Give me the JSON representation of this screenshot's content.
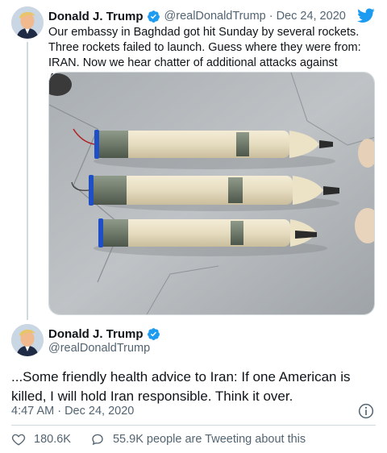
{
  "parent_tweet": {
    "author_name": "Donald J. Trump",
    "handle": "@realDonaldTrump",
    "separator": "·",
    "date": "Dec 24, 2020",
    "text": "Our embassy in Baghdad got hit Sunday by several rockets. Three rockets failed to launch. Guess where they were from: IRAN. Now we hear chatter of additional attacks against Americans in Iraq...",
    "media_icon": "photo-of-three-rockets",
    "brand_icon": "twitter-bird-icon"
  },
  "main_tweet": {
    "author_name": "Donald J. Trump",
    "handle": "@realDonaldTrump",
    "text": "...Some friendly health advice to Iran: If one American is killed, I will hold Iran responsible. Think it over.",
    "timestamp": "4:47 AM · Dec 24, 2020",
    "info_icon": "info-icon"
  },
  "actions": {
    "likes": "180.6K",
    "reply_text": "55.9K people are Tweeting about this",
    "like_icon": "heart-icon",
    "reply_icon": "speech-bubble-icon"
  },
  "colors": {
    "brand_blue": "#1d9bf0",
    "text": "#0f1419",
    "secondary": "#536471",
    "border": "#cfd9de"
  }
}
